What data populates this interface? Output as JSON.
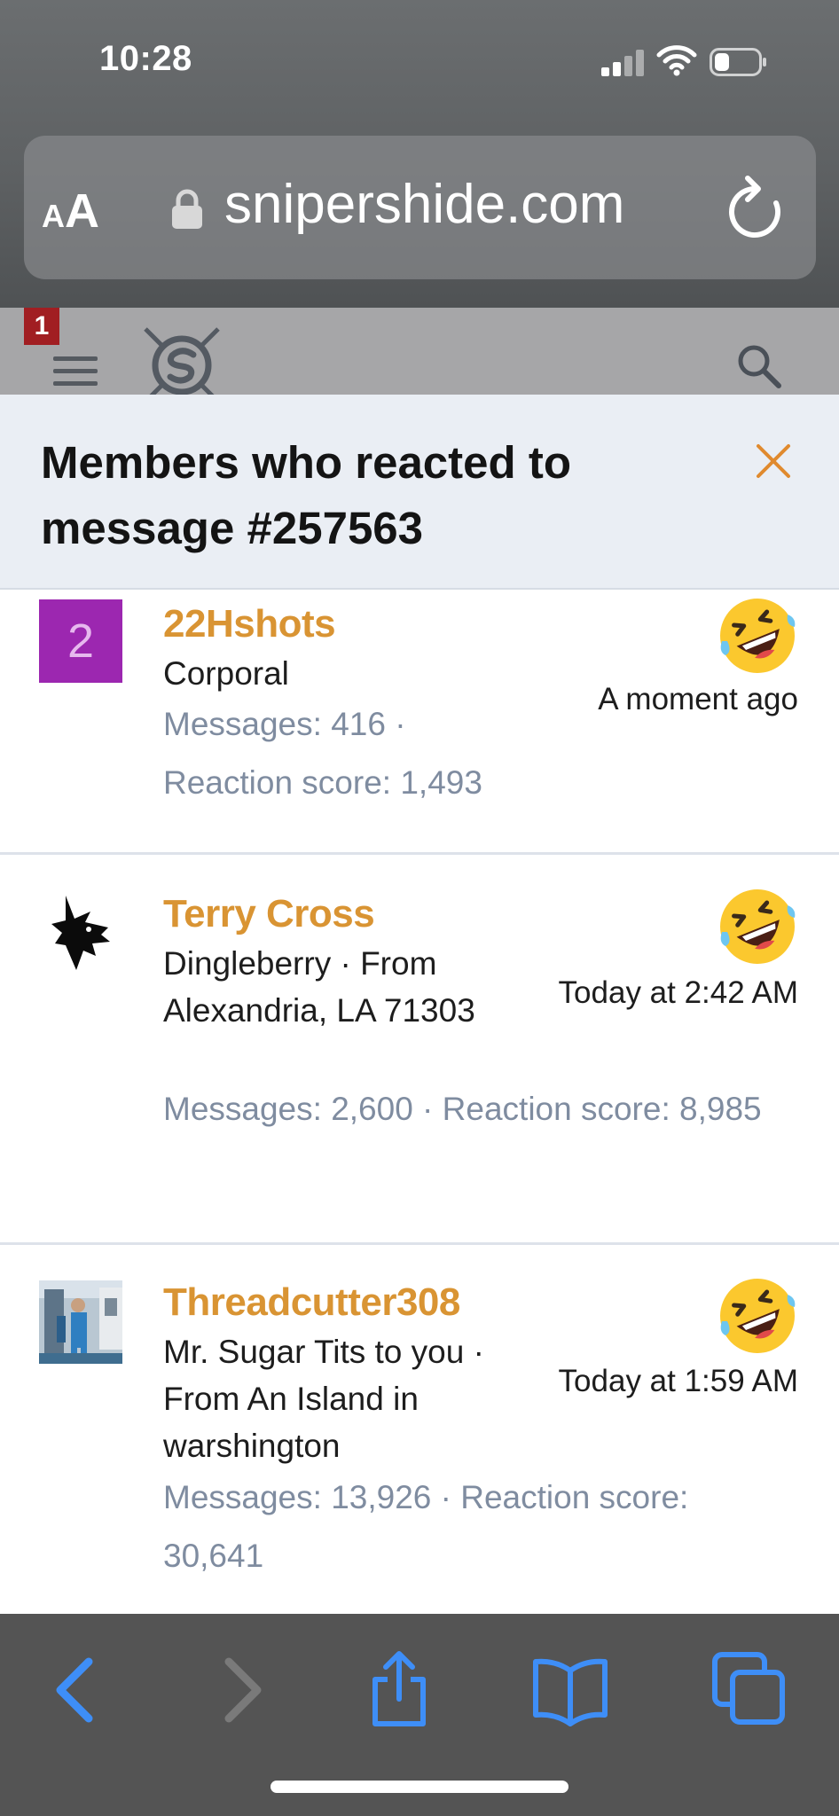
{
  "status_bar": {
    "time": "10:28"
  },
  "url_bar": {
    "text_size_label_small": "A",
    "text_size_label_big": "A",
    "domain": "snipershide.com"
  },
  "site_header": {
    "alert_count": "1"
  },
  "overlay": {
    "title": "Members who reacted to message #257563",
    "members": [
      {
        "avatar_letter": "2",
        "name": "22Hshots",
        "title": "Corporal",
        "stats": "Messages: 416 · Reaction score: 1,493",
        "time": "A moment ago",
        "reaction": "rolling-on-floor-laughing-emoji"
      },
      {
        "name": "Terry Cross",
        "title": "Dingleberry · From Alexandria, LA 71303",
        "stats": "Messages: 2,600 · Reaction score: 8,985",
        "time": "Today at 2:42 AM",
        "reaction": "rolling-on-floor-laughing-emoji"
      },
      {
        "name": "Threadcutter308",
        "title": "Mr. Sugar Tits to you · From An Island in warshington",
        "stats": "Messages: 13,926 · Reaction score: 30,641",
        "time": "Today at 1:59 AM",
        "reaction": "rolling-on-floor-laughing-emoji"
      }
    ]
  },
  "colors": {
    "member_name": "#d99433",
    "stats": "#7f8ca0",
    "close_icon": "#e08a2e",
    "toolbar_active": "#3e8ef7",
    "avatar_purple": "#9c27b0"
  }
}
